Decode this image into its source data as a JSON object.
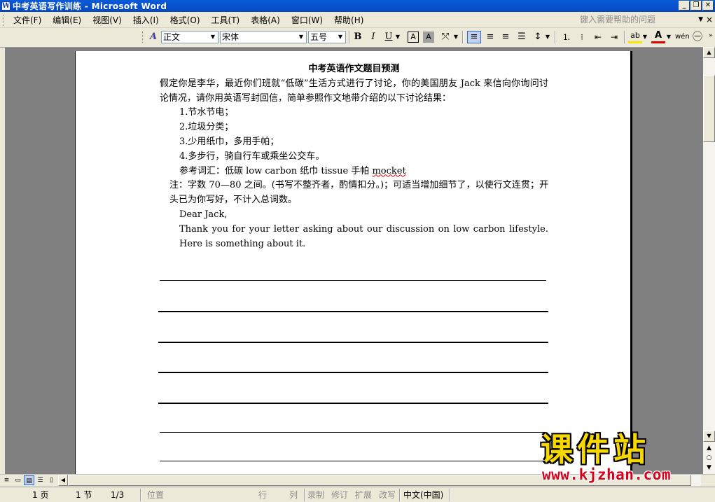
{
  "window": {
    "icon_letter": "W",
    "title": "中考英语写作训练 - Microsoft Word",
    "btn_min": "_",
    "btn_restore": "❐",
    "btn_close": "✕"
  },
  "menu": {
    "items": [
      "文件(F)",
      "编辑(E)",
      "视图(V)",
      "插入(I)",
      "格式(O)",
      "工具(T)",
      "表格(A)",
      "窗口(W)",
      "帮助(H)"
    ],
    "help_placeholder": "键入需要帮助的问题",
    "close_doc": "×"
  },
  "toolbar": {
    "style_value": "正文",
    "font_value": "宋体",
    "size_value": "五号",
    "bold": "B",
    "italic": "I",
    "underline": "U",
    "char_border": "A",
    "char_shading": "A",
    "scale": "A",
    "more": "»"
  },
  "document": {
    "title": "中考英语作文题目预测",
    "intro": "假定你是李华，最近你们班就“低碳”生活方式进行了讨论，你的美国朋友 Jack 来信向你询问讨论情况，请你用英语写封回信，简单参照作文地带介绍的以下讨论结果：",
    "items": [
      "1.节水节电；",
      "2.垃圾分类；",
      "3.少用纸巾，多用手帕；",
      "4.多步行，骑自行车或乘坐公交车。"
    ],
    "vocab_prefix": "参考词汇：低碳 low carbon  纸巾 tissue 手帕 ",
    "vocab_word": "mocket",
    "note": "注：字数 70—80 之间。(书写不整齐者，酌情扣分。)；可适当增加细节了，以使行文连贯；开头已为你写好，不计入总词数。",
    "greeting": "Dear Jack,",
    "opening": "Thank you for your letter asking about our discussion on low carbon lifestyle. Here is something about it."
  },
  "statusbar": {
    "page": "1 页",
    "section": "1 节",
    "page_of": "1/3",
    "position": "位置",
    "line": "行",
    "column": "列",
    "rec": "录制",
    "trk": "修订",
    "ext": "扩展",
    "ovr": "改写",
    "language": "中文(中国)"
  },
  "watermark": {
    "logo": "课件站",
    "url": "www.kjzhan.com"
  },
  "colors": {
    "titlebar": "#0a5bd8",
    "chrome": "#ece9d8",
    "workspace": "#808080",
    "watermark_logo": "#f7d700",
    "watermark_url": "#d6001c"
  }
}
